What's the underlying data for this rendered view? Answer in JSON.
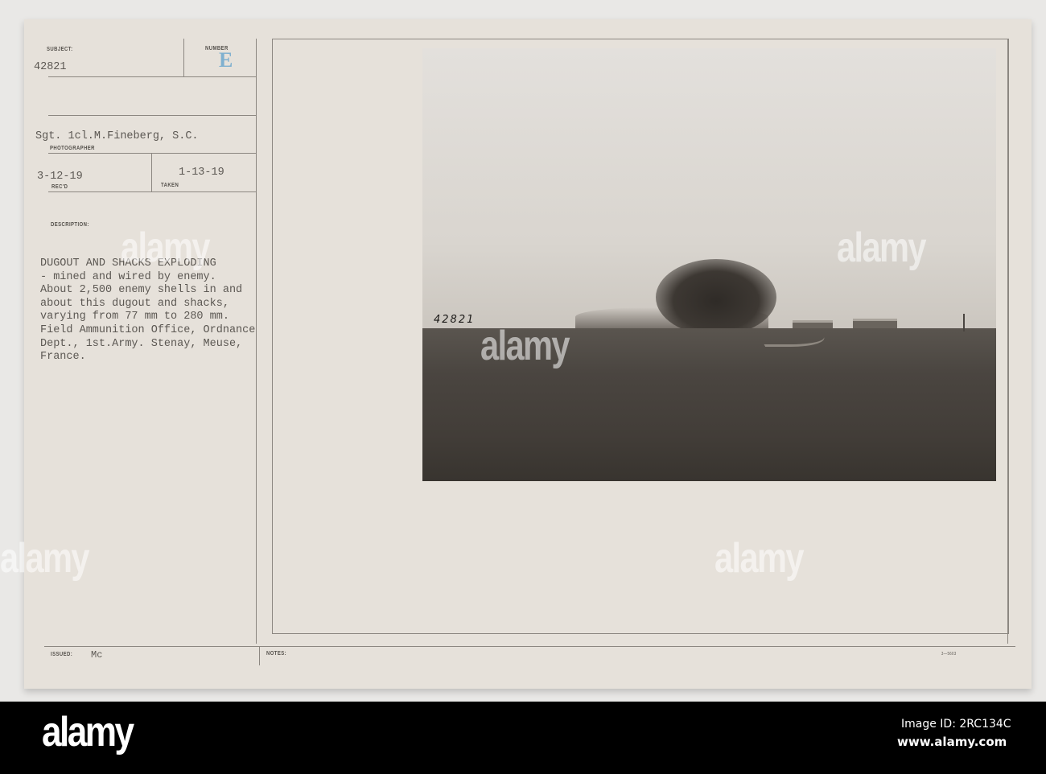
{
  "card": {
    "subject_label": "SUBJECT:",
    "subject_value": "42821",
    "number_label": "NUMBER",
    "number_value": "E",
    "photographer_value": "Sgt. 1cl.M.Fineberg, S.C.",
    "photographer_label": "PHOTOGRAPHER",
    "recd_value": "3-12-19",
    "recd_label": "REC'D",
    "taken_value": "1-13-19",
    "taken_label": "TAKEN",
    "description_label": "DESCRIPTION:",
    "description_lines": [
      "DUGOUT AND SHACKS EXPLODING",
      "- mined and wired by enemy.",
      "About 2,500 enemy shells in and",
      "about this dugout and shacks,",
      "varying from 77 mm to 280 mm.",
      "Field Ammunition Office, Ordnance",
      "Dept., 1st.Army. Stenay, Meuse,",
      "France."
    ],
    "issued_label": "ISSUED:",
    "issued_value": "Mc",
    "notes_label": "NOTES:",
    "form_code": "3—5603"
  },
  "photo": {
    "handwritten_number": "42821"
  },
  "watermark": "alamy",
  "footer": {
    "logo": "alamy",
    "image_id": "Image ID: 2RC134C",
    "url": "www.alamy.com"
  }
}
